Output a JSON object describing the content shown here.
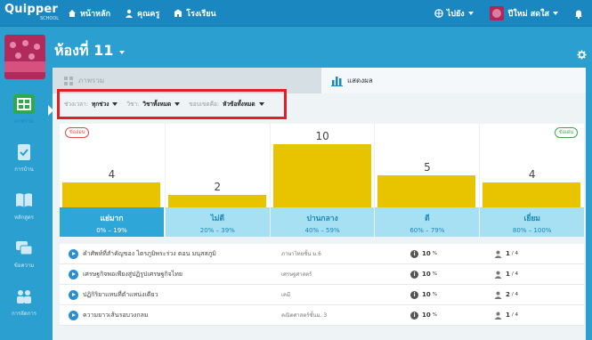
{
  "app": {
    "logo": "Quipper",
    "logo_sub": "SCHOOL"
  },
  "nav": [
    {
      "label": "หน้าหลัก",
      "icon": "home-icon"
    },
    {
      "label": "คุณครู",
      "icon": "teachers-icon"
    },
    {
      "label": "โรงเรียน",
      "icon": "school-icon"
    }
  ],
  "topright": {
    "goto_label": "ไปยัง",
    "user_name": "ปีใหม่ สดใส"
  },
  "class": {
    "title": "ห้องที่ 11"
  },
  "sidebar": [
    {
      "label": "ภาพรวม",
      "icon": "overview-icon",
      "active": true
    },
    {
      "label": "การบ้าน",
      "icon": "homework-icon"
    },
    {
      "label": "หลักสูตร",
      "icon": "curriculum-icon"
    },
    {
      "label": "ข้อความ",
      "icon": "messages-icon"
    },
    {
      "label": "การจัดการ",
      "icon": "management-icon"
    }
  ],
  "tabs": {
    "overview": "ภาพรวม",
    "results": "แสดงผล"
  },
  "filters": {
    "period_label": "ช่วงเวลา:",
    "period_value": "ทุกช่วง",
    "subject_label": "วิชา:",
    "subject_value": "วิชาทั้งหมด",
    "scope_label": "ขอบเขตคือ:",
    "scope_value": "หัวข้อทั้งหมด"
  },
  "chart_data": {
    "type": "bar",
    "categories": [
      "แย่มาก",
      "ไม่ดี",
      "ปานกลาง",
      "ดี",
      "เยี่ยม"
    ],
    "ranges": [
      "0% – 19%",
      "20% – 39%",
      "40% – 59%",
      "60% – 79%",
      "80% – 100%"
    ],
    "values": [
      4,
      2,
      10,
      5,
      4
    ],
    "ylim": [
      0,
      10
    ],
    "low_tag": "ข้ออ่อน",
    "high_tag": "ข้อเด่น",
    "bar_color": "#e8c300",
    "selected_index": 0
  },
  "topics": [
    {
      "title": "คำศัพท์ที่สำคัญของ ไตรภูมิพระร่วง ตอน มนุสสภูมิ",
      "subject": "ภาษาไทยชั้น ม.6",
      "percent": "10",
      "percent_unit": "%",
      "students": "1",
      "students_total": "/ 4"
    },
    {
      "title": "เศรษฐกิจพอเพียงสู่ปฏิรูปเศรษฐกิจไทย",
      "subject": "เศรษฐศาสตร์",
      "percent": "10",
      "percent_unit": "%",
      "students": "1",
      "students_total": "/ 4"
    },
    {
      "title": "ปฏิกิริยาแทนที่ตำแหน่งเดียว",
      "subject": "เคมี",
      "percent": "10",
      "percent_unit": "%",
      "students": "2",
      "students_total": "/ 4"
    },
    {
      "title": "ความยาวเส้นรอบวงกลม",
      "subject": "คณิตศาสตร์ชั้นม. 3",
      "percent": "10",
      "percent_unit": "%",
      "students": "1",
      "students_total": "/ 4"
    }
  ]
}
